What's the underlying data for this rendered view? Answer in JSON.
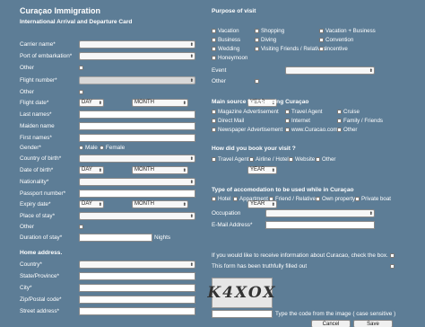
{
  "form": {
    "title": "Curaçao Immigration",
    "subtitle": "International Arrival and Departure Card"
  },
  "left": {
    "carrier_name": "Carrier name*",
    "port_of_embarkation": "Port of embarkation*",
    "other1": "Other",
    "flight_number": "Flight number*",
    "other2": "Other",
    "flight_date": "Flight date*",
    "day": "DAY",
    "month": "MONTH",
    "year": "YEAR",
    "last_names": "Last names*",
    "maiden_name": "Maiden name",
    "first_names": "First names*",
    "gender": "Gender*",
    "male": "Male",
    "female": "Female",
    "country_of_birth": "Country of birth*",
    "date_of_birth": "Date of birth*",
    "nationality": "Nationality*",
    "passport_number": "Passport number*",
    "expiry_date": "Expiry date*",
    "place_of_stay": "Place of stay*",
    "other3": "Other",
    "duration_of_stay": "Duration of stay*",
    "nights": "Nights",
    "home_address": "Home address.",
    "country": "Country*",
    "state_province": "State/Province*",
    "city": "City*",
    "zip": "Zip/Postal code*",
    "street": "Street address*"
  },
  "purpose": {
    "title": "Purpose of visit",
    "vacation": "Vacation",
    "shopping": "Shopping",
    "vacation_business": "Vacation + Business",
    "business": "Business",
    "diving": "Diving",
    "convention": "Convention",
    "wedding": "Wedding",
    "visiting": "Visiting Friends / Relatives",
    "incentive": "Incentive",
    "honeymoon": "Honeymoon",
    "event": "Event",
    "other": "Other"
  },
  "source": {
    "title": "Main source for choosing Curaçao",
    "magazine": "Magazine Advertisement",
    "travel_agent": "Travel Agent",
    "cruise": "Cruise",
    "direct_mail": "Direct Mail",
    "internet": "Internet",
    "family": "Family / Friends",
    "newspaper": "Newspaper Advertisement",
    "website": "www.Curacao.com",
    "other": "Other"
  },
  "booking": {
    "title": "How did you book your visit ?",
    "travel_agent": "Travel Agent",
    "airline_hotel": "Airline / Hotel",
    "website": "Website",
    "other": "Other"
  },
  "accommodation": {
    "title": "Type of accomodation to be used while in Curaçao",
    "hotel": "Hotel",
    "apartment": "Appartment",
    "friend": "Friend / Relative",
    "own": "Own property",
    "private": "Private boat",
    "occupation": "Occupation",
    "email": "E-Mail Address*"
  },
  "footer": {
    "info_text": "If you would like to receive information about Curacao, check the box.",
    "truthful": "This form has been truthfully filled out",
    "captcha_text": "K4XOX",
    "captcha_hint": "Type the code from the image ( case sensitive )",
    "cancel": "Cancel",
    "save": "Save"
  }
}
